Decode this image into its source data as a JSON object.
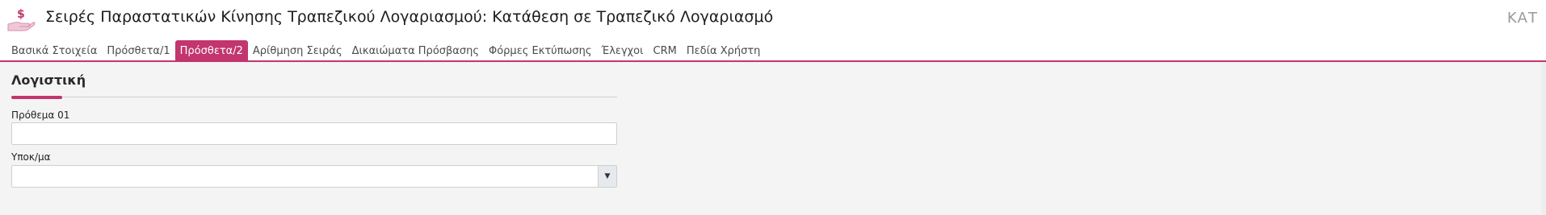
{
  "header": {
    "title": "Σειρές Παραστατικών Κίνησης Τραπεζικού Λογαριασμού: Κατάθεση σε Τραπεζικό Λογαριασμό",
    "corner_code": "ΚΑΤ",
    "icon": "hand-dollar-icon",
    "accent_color": "#c2356e"
  },
  "tabs": [
    {
      "label": "Βασικά Στοιχεία"
    },
    {
      "label": "Πρόσθετα/1"
    },
    {
      "label": "Πρόσθετα/2",
      "active": true
    },
    {
      "label": "Αρίθμηση Σειράς"
    },
    {
      "label": "Δικαιώματα Πρόσβασης"
    },
    {
      "label": "Φόρμες Εκτύπωσης"
    },
    {
      "label": "Έλεγχοι"
    },
    {
      "label": "CRM"
    },
    {
      "label": "Πεδία Χρήστη"
    }
  ],
  "section": {
    "title": "Λογιστική"
  },
  "fields": {
    "prothema": {
      "label": "Πρόθεμα 01",
      "value": ""
    },
    "ypokatastima": {
      "label": "Υποκ/μα",
      "value": "",
      "dropdown_icon": "caret-down-icon"
    }
  }
}
